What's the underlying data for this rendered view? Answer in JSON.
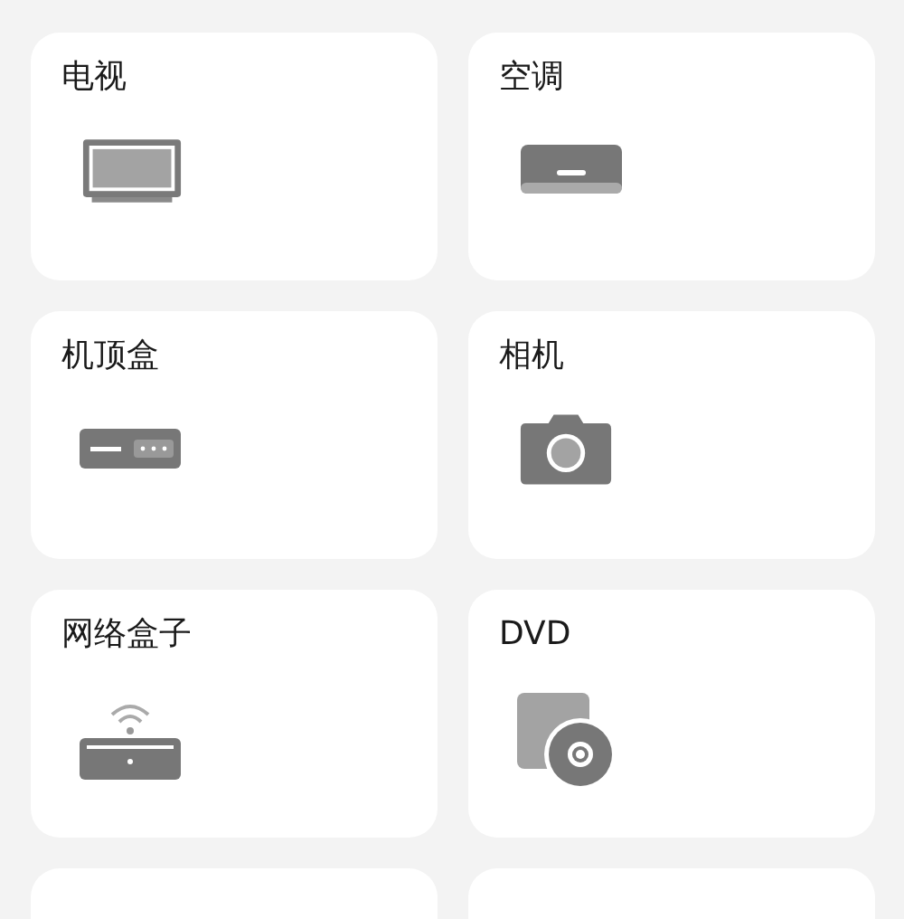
{
  "devices": [
    {
      "name": "电视",
      "kind": "tv"
    },
    {
      "name": "空调",
      "kind": "ac"
    },
    {
      "name": "机顶盒",
      "kind": "settopbox"
    },
    {
      "name": "相机",
      "kind": "camera"
    },
    {
      "name": "网络盒子",
      "kind": "netbox"
    },
    {
      "name": "DVD",
      "kind": "dvd"
    },
    {
      "kind": "none"
    },
    {
      "kind": "none"
    }
  ]
}
